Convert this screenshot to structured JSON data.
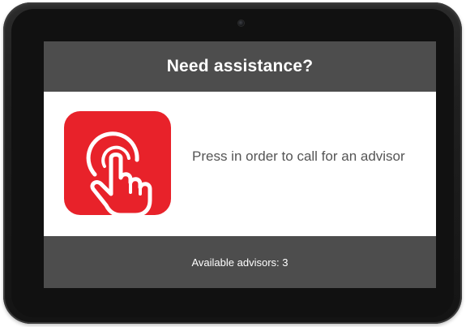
{
  "header": {
    "title": "Need assistance?"
  },
  "call_button": {
    "icon": "hand-tap-icon",
    "color": "#e8222a"
  },
  "message": {
    "text": "Press in order to call for an advisor"
  },
  "footer": {
    "label": "Available advisors:",
    "count": "3"
  },
  "colors": {
    "bar": "#4d4d4d",
    "accent": "#e8222a",
    "text_on_bar": "#ffffff",
    "message_text": "#555555"
  }
}
